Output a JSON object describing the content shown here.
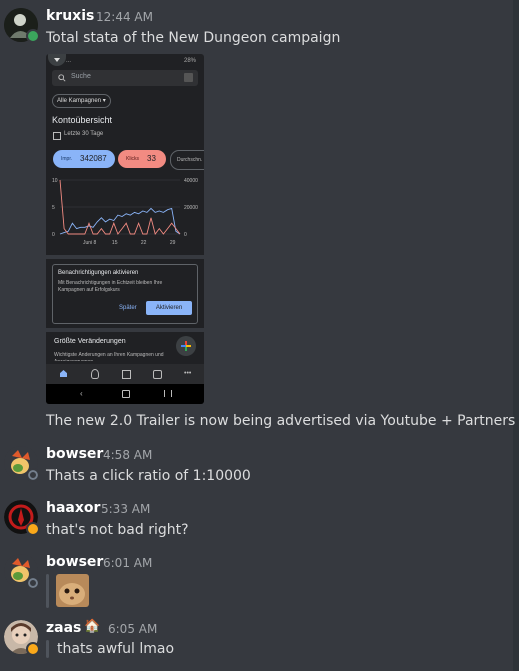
{
  "messages": [
    {
      "user": "kruxis",
      "time": "12:44 AM",
      "text": "Total stata of the New Dungeon campaign"
    },
    {
      "user": "",
      "time": "",
      "text": "The new 2.0 Trailer is now being advertised via Youtube + Partners"
    },
    {
      "user": "bowser",
      "time": "4:58 AM",
      "text": "Thats a click ratio of 1:10000"
    },
    {
      "user": "haaxor",
      "time": "5:33 AM",
      "text": "that's not bad right?"
    },
    {
      "user": "bowser",
      "time": "6:01 AM",
      "text": ""
    },
    {
      "user": "zaas",
      "time": "6:05 AM",
      "text": "thats awful lmao",
      "badge": "🏠"
    }
  ],
  "phone": {
    "status_left": "...",
    "status_right": "28%",
    "search_placeholder": "Suche",
    "campaign_select": "Alle Kampagnen ▾",
    "overview_title": "Kontoübersicht",
    "date_range": "Letzte 30 Tage",
    "metrics": [
      {
        "label": "Impr.",
        "value": "342087",
        "color": "#8ab4f8"
      },
      {
        "label": "Klicks",
        "value": "33",
        "color": "#f28b82"
      },
      {
        "label": "Durchschn.",
        "value": "",
        "color": ""
      }
    ],
    "chart_left_ticks": [
      "10",
      "5",
      "0"
    ],
    "chart_right_ticks": [
      "40000",
      "20000",
      "0"
    ],
    "chart_x_ticks": [
      "Juni 8",
      "15",
      "22",
      "29"
    ],
    "notification_title": "Benachrichtigungen aktivieren",
    "notification_text": "Mit Benachrichtigungen in Echtzeit bleiben Ihre Kampagnen auf Erfolgskurs",
    "later_button": "Später",
    "activate_button": "Aktivieren",
    "changes_title": "Größte Veränderungen",
    "changes_text": "Wichtigste Änderungen an Ihren Kampagnen und Anzeigengruppen"
  },
  "chart_data": {
    "type": "line",
    "x": [
      "Juni 1",
      "Juni 2",
      "Juni 3",
      "Juni 4",
      "Juni 5",
      "Juni 6",
      "Juni 7",
      "Juni 8",
      "Juni 9",
      "Juni 10",
      "Juni 11",
      "Juni 12",
      "Juni 13",
      "Juni 14",
      "Juni 15",
      "Juni 16",
      "Juni 17",
      "Juni 18",
      "Juni 19",
      "Juni 20",
      "Juni 21",
      "Juni 22",
      "Juni 23",
      "Juni 24",
      "Juni 25",
      "Juni 26",
      "Juni 27",
      "Juni 28",
      "Juni 29",
      "Juni 30"
    ],
    "series": [
      {
        "name": "Impr.",
        "axis": "right",
        "values": [
          0,
          1000,
          2000,
          8000,
          4000,
          5000,
          5000,
          6000,
          5000,
          9000,
          12000,
          9000,
          11000,
          10000,
          14000,
          13000,
          15000,
          14000,
          16000,
          15000,
          17000,
          16000,
          19000,
          16000,
          17000,
          16000,
          18000,
          19000,
          2000,
          0
        ]
      },
      {
        "name": "Klicks",
        "axis": "left",
        "values": [
          10,
          1,
          0,
          0,
          0,
          0,
          0,
          2,
          0,
          0,
          1,
          0,
          0,
          2,
          0,
          1,
          2,
          0,
          0,
          2,
          0,
          0,
          3,
          0,
          1,
          0,
          1,
          2,
          1,
          0
        ]
      }
    ],
    "ylim_left": [
      0,
      10
    ],
    "ylim_right": [
      0,
      40000
    ]
  }
}
